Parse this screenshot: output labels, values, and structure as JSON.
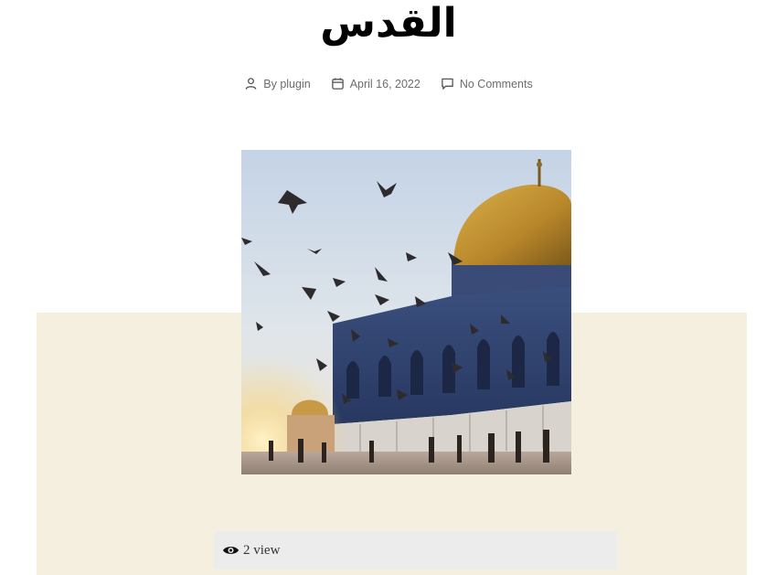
{
  "post": {
    "title": "القدس",
    "meta": {
      "author_label": "By plugin",
      "date": "April 16, 2022",
      "comments": "No Comments"
    },
    "featured_image": {
      "alt_subject": "Dome of the Rock with flying pigeons"
    }
  },
  "views_widget": {
    "count_label": "2 view",
    "icon": "eye-icon"
  },
  "icons": {
    "author": "user-icon",
    "date": "calendar-icon",
    "comments": "comment-icon"
  },
  "colors": {
    "band": "#f5efe0",
    "views_bg": "#ececec",
    "meta_text": "#6d6d6d",
    "title": "#000000"
  }
}
